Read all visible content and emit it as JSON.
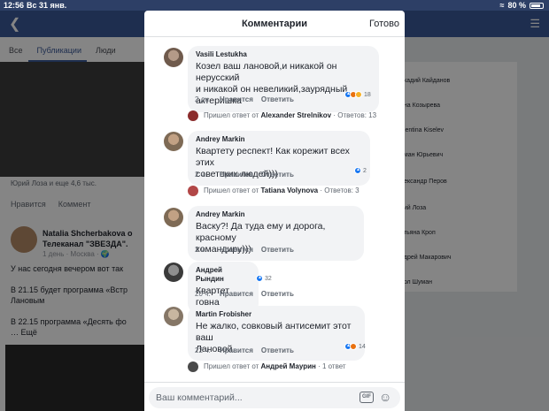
{
  "status_bar": {
    "time": "12:56",
    "date": "Вс 31 янв.",
    "battery": "80 %",
    "battery_level": 0.8
  },
  "background": {
    "tabs": [
      "Все",
      "Публикации",
      "Люди"
    ],
    "likes_text": "Юрий Лоза и еще 4,6 тыс.",
    "like_label": "Нравится",
    "comment_label": "Коммент",
    "post_author": "Natalia Shcherbakova о\nТелеканал \"ЗВЕЗДА\".",
    "post_meta": "1 день · Москва · 🌍",
    "post_text": "У нас сегодня вечером вот так\n\nВ 21.15 будет программа «Встр\nЛановым\n\nВ 22.15 программа «Десять фо\n… Ещё",
    "people": [
      "ркадий Кайданов",
      "ина Козырева",
      "alentina Kiselev",
      "оман Юрьевич",
      "лександр Перов",
      "рий Лоза",
      "атьяна Кроп",
      "ндрей Макарович",
      "арл Шуман"
    ]
  },
  "sheet": {
    "title": "Комментарии",
    "done_label": "Готово",
    "like_label": "Нравится",
    "reply_label": "Ответить",
    "comments": [
      {
        "author": "Vasili Lestukha",
        "text": "Козел ваш лановой,и никакой он нерусский\nи никакой он невеликий,заурядный\nактеришка",
        "time": "2 дн.",
        "reactions": "18",
        "reply": {
          "prefix": "Пришел ответ от",
          "author": "Alexander Strelnikov",
          "count": "· Ответов: 13"
        }
      },
      {
        "author": "Andrey Markin",
        "text": "Квартету респект! Как корежит всех этих\nсоветских людей)))",
        "time": "2 ч.",
        "reactions": "2",
        "reply": {
          "prefix": "Пришел ответ от",
          "author": "Tatiana Volynova",
          "count": "· Ответов: 3"
        }
      },
      {
        "author": "Andrey Markin",
        "text": "Васку?! Да туда ему и дорога, красному\nкомандиру)))",
        "time": "2 ч.",
        "reactions": ""
      },
      {
        "author": "Андрей Рындин",
        "text": "Квартет говна",
        "time": "20 ч.",
        "reactions": "32"
      },
      {
        "author": "Martin Frobisher",
        "text": "Не жалко, совковый антисемит этот ваш\nЛановой.",
        "time": "22 ч.",
        "reactions": "14",
        "reply": {
          "prefix": "Пришел ответ от",
          "author": "Андрей Маурин",
          "count": "· 1 ответ"
        }
      }
    ]
  },
  "composer": {
    "placeholder": "Ваш комментарий...",
    "gif_label": "GIF"
  }
}
